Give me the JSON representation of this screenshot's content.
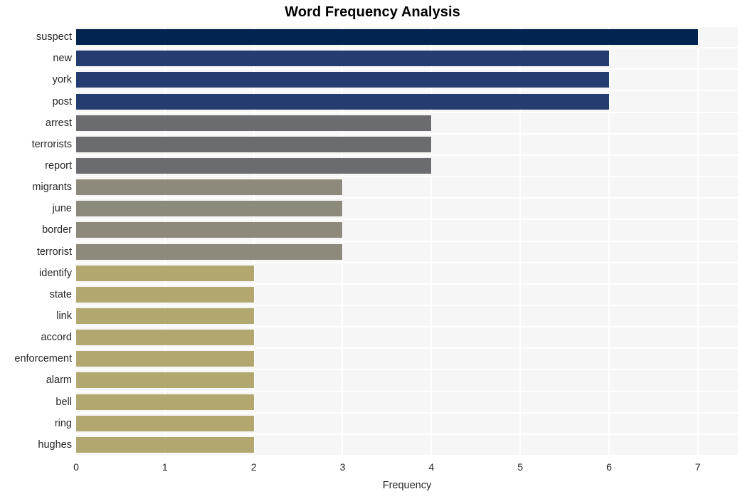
{
  "chart_data": {
    "type": "bar",
    "orientation": "horizontal",
    "title": "Word Frequency Analysis",
    "xlabel": "Frequency",
    "ylabel": "",
    "categories": [
      "suspect",
      "new",
      "york",
      "post",
      "arrest",
      "terrorists",
      "report",
      "migrants",
      "june",
      "border",
      "terrorist",
      "identify",
      "state",
      "link",
      "accord",
      "enforcement",
      "alarm",
      "bell",
      "ring",
      "hughes"
    ],
    "values": [
      7,
      6,
      6,
      6,
      4,
      4,
      4,
      3,
      3,
      3,
      3,
      2,
      2,
      2,
      2,
      2,
      2,
      2,
      2,
      2
    ],
    "bar_colors": [
      "#01254f",
      "#243c70",
      "#243c70",
      "#243c70",
      "#6b6c70",
      "#6b6c70",
      "#6b6c70",
      "#8e8a7b",
      "#8e8a7b",
      "#8e8a7b",
      "#8e8a7b",
      "#b2a76e",
      "#b2a76e",
      "#b2a76e",
      "#b2a76e",
      "#b2a76e",
      "#b2a76e",
      "#b2a76e",
      "#b2a76e",
      "#b2a76e"
    ],
    "xlim": [
      0,
      7.45
    ],
    "xticks": [
      0,
      1,
      2,
      3,
      4,
      5,
      6,
      7
    ],
    "xtick_labels": [
      "0",
      "1",
      "2",
      "3",
      "4",
      "5",
      "6",
      "7"
    ],
    "grid": true,
    "grid_color": "#ffffff",
    "plot_background": "#f6f6f6",
    "figure_background": "#ffffff",
    "legend": null
  }
}
